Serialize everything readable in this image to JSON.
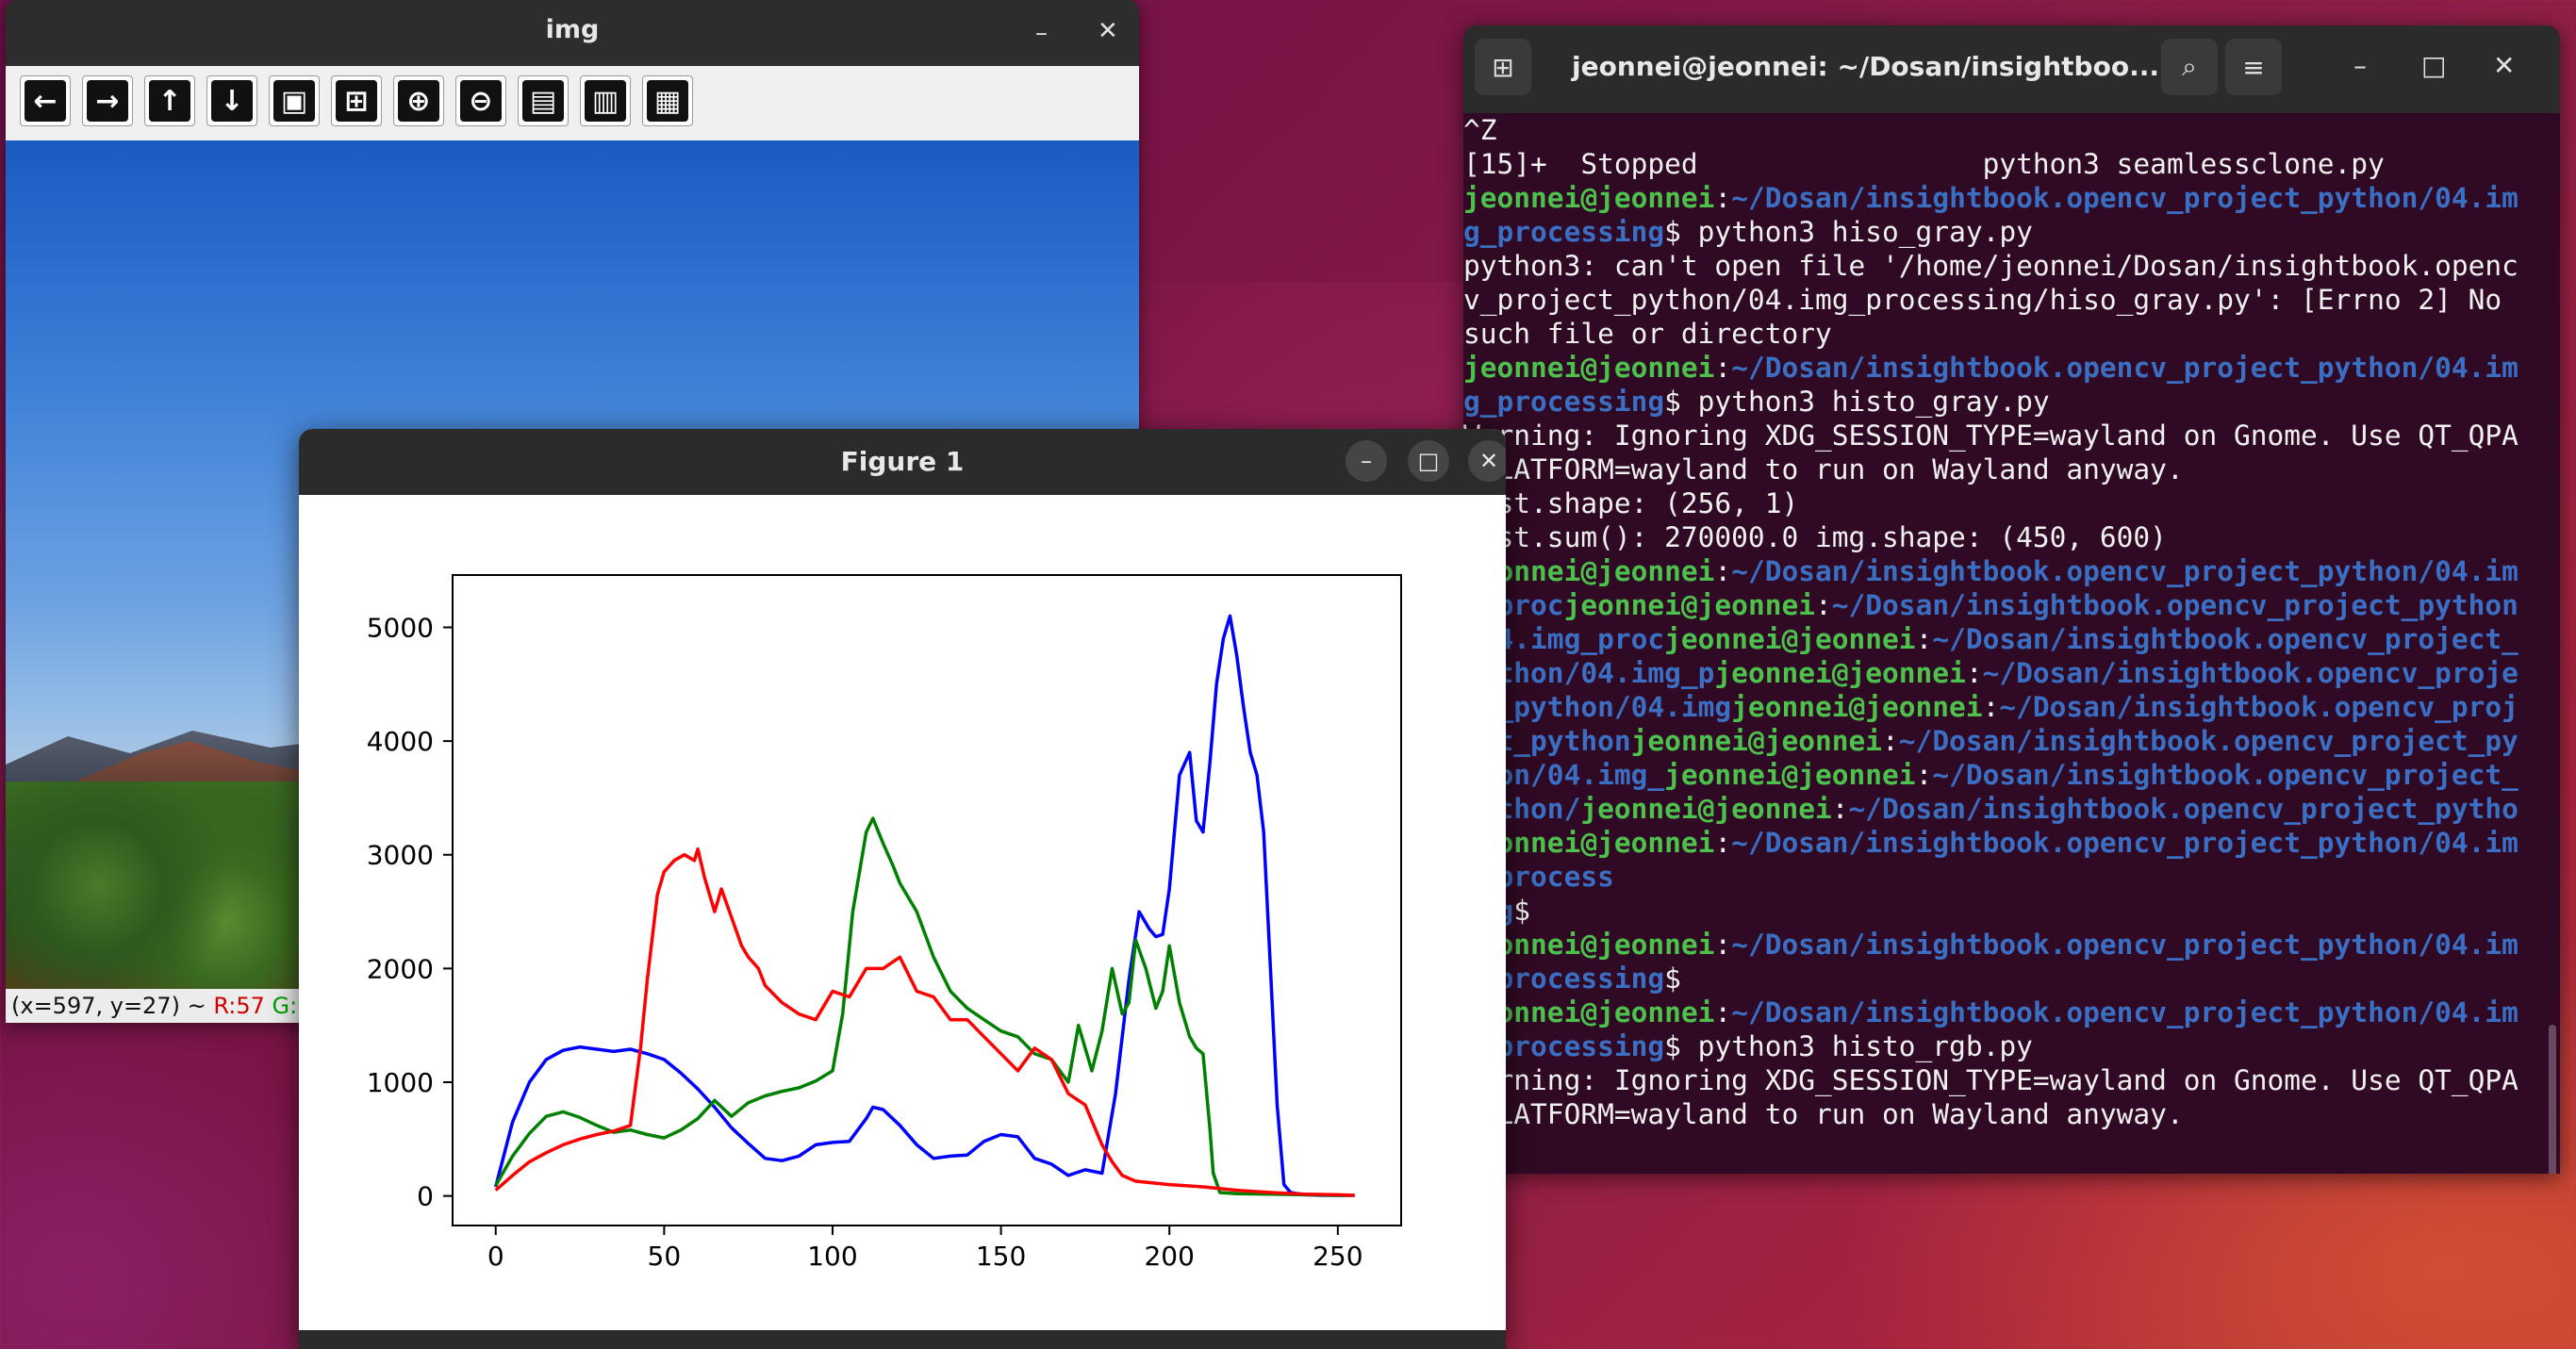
{
  "img_window": {
    "title": "img",
    "minimize_glyph": "–",
    "close_glyph": "✕",
    "toolbar_buttons": [
      {
        "name": "pan-left-icon",
        "glyph": "←"
      },
      {
        "name": "pan-right-icon",
        "glyph": "→"
      },
      {
        "name": "pan-up-icon",
        "glyph": "↑"
      },
      {
        "name": "pan-down-icon",
        "glyph": "↓"
      },
      {
        "name": "zoom-fit-icon",
        "glyph": "▣"
      },
      {
        "name": "zoom-original-icon",
        "glyph": "⊞"
      },
      {
        "name": "zoom-in-icon",
        "glyph": "⊕"
      },
      {
        "name": "zoom-out-icon",
        "glyph": "⊖"
      },
      {
        "name": "save-icon",
        "glyph": "▤"
      },
      {
        "name": "copy-clipboard-icon",
        "glyph": "▥"
      },
      {
        "name": "properties-icon",
        "glyph": "▦"
      }
    ],
    "status": {
      "coords": "(x=597, y=27) ~ ",
      "r": "R:57",
      "g": "G:"
    }
  },
  "terminal": {
    "title": "jeonnei@jeonnei: ~/Dosan/insightboo...",
    "newtab_glyph": "⊞",
    "search_glyph": "⌕",
    "menu_glyph": "≡",
    "minimize_glyph": "–",
    "maximize_glyph": "□",
    "close_glyph": "✕",
    "lines": [
      [
        {
          "t": "^Z",
          "c": "plain"
        }
      ],
      [
        {
          "t": "[15]+  Stopped                 python3 seamlessclone.py",
          "c": "plain"
        }
      ],
      [
        {
          "t": "jeonnei@jeonnei",
          "c": "host"
        },
        {
          "t": ":",
          "c": "plain"
        },
        {
          "t": "~/Dosan/insightbook.opencv_project_python/04.im",
          "c": "path"
        }
      ],
      [
        {
          "t": "g_processing",
          "c": "path"
        },
        {
          "t": "$ python3 hiso_gray.py",
          "c": "plain"
        }
      ],
      [
        {
          "t": "python3: can't open file '/home/jeonnei/Dosan/insightbook.openc",
          "c": "plain"
        }
      ],
      [
        {
          "t": "v_project_python/04.img_processing/hiso_gray.py': [Errno 2] No",
          "c": "plain"
        }
      ],
      [
        {
          "t": "such file or directory",
          "c": "plain"
        }
      ],
      [
        {
          "t": "jeonnei@jeonnei",
          "c": "host"
        },
        {
          "t": ":",
          "c": "plain"
        },
        {
          "t": "~/Dosan/insightbook.opencv_project_python/04.im",
          "c": "path"
        }
      ],
      [
        {
          "t": "g_processing",
          "c": "path"
        },
        {
          "t": "$ python3 histo_gray.py",
          "c": "plain"
        }
      ],
      [
        {
          "t": "Warning: Ignoring XDG_SESSION_TYPE=wayland on Gnome. Use QT_QPA",
          "c": "plain"
        }
      ],
      [
        {
          "t": "_PLATFORM=wayland to run on Wayland anyway.",
          "c": "plain"
        }
      ],
      [
        {
          "t": "hist.shape: (256, 1)",
          "c": "plain"
        }
      ],
      [
        {
          "t": "hist.sum(): 270000.0 img.shape: (450, 600)",
          "c": "plain"
        }
      ],
      [
        {
          "t": "jeonnei@jeonnei",
          "c": "host"
        },
        {
          "t": ":",
          "c": "plain"
        },
        {
          "t": "~/Dosan/insightbook.opencv_project_python/04.im",
          "c": "path"
        }
      ],
      [
        {
          "t": "g_proc",
          "c": "path"
        },
        {
          "t": "jeonnei@jeonnei",
          "c": "host"
        },
        {
          "t": ":",
          "c": "plain"
        },
        {
          "t": "~/Dosan/insightbook.opencv_project_python",
          "c": "path"
        }
      ],
      [
        {
          "t": "/04.img_proc",
          "c": "path"
        },
        {
          "t": "jeonnei@jeonnei",
          "c": "host"
        },
        {
          "t": ":",
          "c": "plain"
        },
        {
          "t": "~/Dosan/insightbook.opencv_project_",
          "c": "path"
        }
      ],
      [
        {
          "t": "python/04.img_p",
          "c": "path"
        },
        {
          "t": "jeonnei@jeonnei",
          "c": "host"
        },
        {
          "t": ":",
          "c": "plain"
        },
        {
          "t": "~/Dosan/insightbook.opencv_proje",
          "c": "path"
        }
      ],
      [
        {
          "t": "ct_python/04.img",
          "c": "path"
        },
        {
          "t": "jeonnei@jeonnei",
          "c": "host"
        },
        {
          "t": ":",
          "c": "plain"
        },
        {
          "t": "~/Dosan/insightbook.opencv_proj",
          "c": "path"
        }
      ],
      [
        {
          "t": "ect_python",
          "c": "path"
        },
        {
          "t": "jeonnei@jeonnei",
          "c": "host"
        },
        {
          "t": ":",
          "c": "plain"
        },
        {
          "t": "~/Dosan/insightbook.opencv_project_py",
          "c": "path"
        }
      ],
      [
        {
          "t": "thon/04.img_",
          "c": "path"
        },
        {
          "t": "jeonnei@jeonnei",
          "c": "host"
        },
        {
          "t": ":",
          "c": "plain"
        },
        {
          "t": "~/Dosan/insightbook.opencv_project_",
          "c": "path"
        }
      ],
      [
        {
          "t": "python/",
          "c": "path"
        },
        {
          "t": "jeonnei@jeonnei",
          "c": "host"
        },
        {
          "t": ":",
          "c": "plain"
        },
        {
          "t": "~/Dosan/insightbook.opencv_project_pytho",
          "c": "path"
        }
      ],
      [
        {
          "t": "jeonnei@jeonnei",
          "c": "host"
        },
        {
          "t": ":",
          "c": "plain"
        },
        {
          "t": "~/Dosan/insightbook.opencv_project_python/04.im",
          "c": "path"
        }
      ],
      [
        {
          "t": "g_process",
          "c": "path"
        }
      ],
      [
        {
          "t": "ing",
          "c": "path"
        },
        {
          "t": "$",
          "c": "plain"
        }
      ],
      [
        {
          "t": "jeonnei@jeonnei",
          "c": "host"
        },
        {
          "t": ":",
          "c": "plain"
        },
        {
          "t": "~/Dosan/insightbook.opencv_project_python/04.im",
          "c": "path"
        }
      ],
      [
        {
          "t": "g_processing",
          "c": "path"
        },
        {
          "t": "$",
          "c": "plain"
        }
      ],
      [
        {
          "t": "jeonnei@jeonnei",
          "c": "host"
        },
        {
          "t": ":",
          "c": "plain"
        },
        {
          "t": "~/Dosan/insightbook.opencv_project_python/04.im",
          "c": "path"
        }
      ],
      [
        {
          "t": "g_processing",
          "c": "path"
        },
        {
          "t": "$ python3 histo_rgb.py",
          "c": "plain"
        }
      ],
      [
        {
          "t": "Warning: Ignoring XDG_SESSION_TYPE=wayland on Gnome. Use QT_QPA",
          "c": "plain"
        }
      ],
      [
        {
          "t": "_PLATFORM=wayland to run on Wayland anyway.",
          "c": "plain"
        }
      ]
    ]
  },
  "figure_window": {
    "title": "Figure 1",
    "minimize_glyph": "–",
    "maximize_glyph": "□",
    "close_glyph": "✕"
  },
  "chart_data": {
    "type": "line",
    "title": "",
    "xlabel": "",
    "ylabel": "",
    "xlim": [
      -12.8,
      268.8
    ],
    "ylim": [
      -260,
      5460
    ],
    "xticks": [
      0,
      50,
      100,
      150,
      200,
      250
    ],
    "yticks": [
      0,
      1000,
      2000,
      3000,
      4000,
      5000
    ],
    "grid": false,
    "legend": "none",
    "series": [
      {
        "color": "#0000ff",
        "x": [
          0,
          5,
          10,
          15,
          20,
          25,
          30,
          35,
          40,
          45,
          50,
          55,
          60,
          65,
          70,
          75,
          80,
          85,
          90,
          95,
          100,
          105,
          110,
          112,
          115,
          120,
          125,
          130,
          135,
          140,
          145,
          150,
          155,
          160,
          165,
          170,
          175,
          180,
          184,
          188,
          191,
          194,
          196,
          198,
          200,
          203,
          206,
          208,
          210,
          212,
          214,
          216,
          218,
          220,
          222,
          224,
          226,
          228,
          230,
          232,
          234,
          236,
          238,
          240,
          245,
          250,
          255
        ],
        "y": [
          80,
          650,
          1000,
          1200,
          1280,
          1310,
          1290,
          1270,
          1290,
          1250,
          1200,
          1080,
          940,
          780,
          600,
          460,
          330,
          310,
          350,
          450,
          470,
          480,
          680,
          780,
          760,
          620,
          450,
          330,
          350,
          360,
          480,
          540,
          520,
          330,
          280,
          180,
          230,
          200,
          900,
          1900,
          2500,
          2350,
          2280,
          2300,
          2700,
          3700,
          3900,
          3300,
          3200,
          3800,
          4500,
          4900,
          5100,
          4750,
          4300,
          3900,
          3700,
          3200,
          2000,
          800,
          100,
          30,
          20,
          10,
          5,
          5,
          5
        ]
      },
      {
        "color": "#008000",
        "x": [
          0,
          5,
          10,
          15,
          20,
          25,
          30,
          35,
          40,
          45,
          50,
          55,
          60,
          65,
          70,
          75,
          80,
          85,
          90,
          95,
          100,
          103,
          106,
          110,
          112,
          115,
          118,
          120,
          125,
          130,
          135,
          140,
          145,
          150,
          155,
          160,
          165,
          170,
          173,
          175,
          177,
          180,
          183,
          186,
          188,
          190,
          193,
          196,
          198,
          200,
          203,
          206,
          208,
          210,
          212,
          213,
          215,
          220,
          230,
          240,
          250,
          255
        ],
        "y": [
          90,
          350,
          550,
          700,
          740,
          690,
          620,
          560,
          580,
          540,
          510,
          580,
          680,
          840,
          700,
          820,
          880,
          920,
          950,
          1010,
          1100,
          1600,
          2500,
          3200,
          3320,
          3100,
          2900,
          2750,
          2500,
          2100,
          1800,
          1650,
          1550,
          1450,
          1400,
          1250,
          1200,
          1000,
          1500,
          1300,
          1100,
          1450,
          2000,
          1600,
          1700,
          2250,
          2000,
          1650,
          1800,
          2200,
          1700,
          1400,
          1300,
          1250,
          600,
          200,
          30,
          20,
          15,
          10,
          5,
          5
        ]
      },
      {
        "color": "#ff0000",
        "x": [
          0,
          5,
          10,
          15,
          20,
          25,
          30,
          35,
          40,
          43,
          45,
          48,
          50,
          53,
          56,
          59,
          60,
          62,
          65,
          67,
          70,
          73,
          75,
          78,
          80,
          85,
          90,
          95,
          100,
          105,
          110,
          115,
          120,
          125,
          130,
          135,
          140,
          145,
          150,
          155,
          160,
          165,
          170,
          175,
          180,
          183,
          186,
          190,
          200,
          210,
          220,
          230,
          240,
          250,
          255
        ],
        "y": [
          50,
          180,
          300,
          380,
          450,
          500,
          540,
          570,
          620,
          1300,
          1900,
          2650,
          2850,
          2950,
          3000,
          2950,
          3050,
          2800,
          2500,
          2700,
          2450,
          2200,
          2100,
          2000,
          1850,
          1700,
          1600,
          1550,
          1800,
          1750,
          2000,
          2000,
          2100,
          1800,
          1750,
          1550,
          1550,
          1400,
          1250,
          1100,
          1300,
          1200,
          900,
          800,
          450,
          300,
          180,
          130,
          100,
          80,
          50,
          30,
          15,
          10,
          5
        ]
      }
    ]
  }
}
